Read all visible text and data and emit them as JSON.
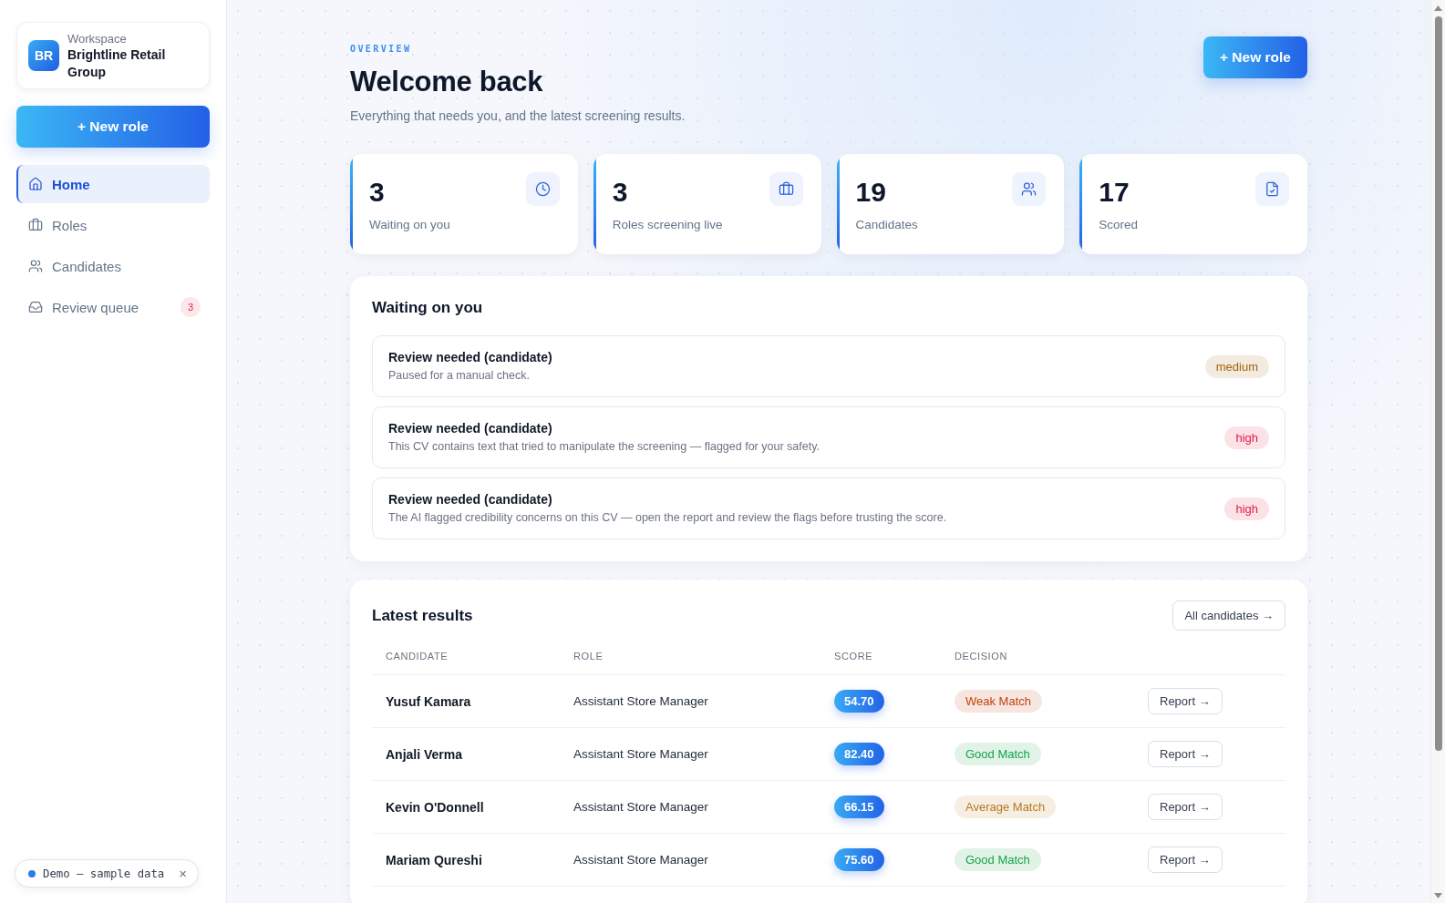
{
  "sidebar": {
    "workspace": {
      "logo": "BR",
      "label": "Workspace",
      "name": "Brightline Retail Group"
    },
    "new_role_button": "+ New role",
    "nav": [
      {
        "label": "Home",
        "selected": true
      },
      {
        "label": "Roles",
        "selected": false
      },
      {
        "label": "Candidates",
        "selected": false
      },
      {
        "label": "Review queue",
        "selected": false,
        "badge": "3"
      }
    ],
    "demo_banner": {
      "label": "Demo — sample data",
      "close": "×"
    }
  },
  "header": {
    "eyebrow": "OVERVIEW",
    "title": "Welcome back",
    "subtitle": "Everything that needs you, and the latest screening results.",
    "new_role_button": "+ New role"
  },
  "stats": [
    {
      "value": "3",
      "label": "Waiting on you"
    },
    {
      "value": "3",
      "label": "Roles screening live"
    },
    {
      "value": "19",
      "label": "Candidates"
    },
    {
      "value": "17",
      "label": "Scored"
    }
  ],
  "waiting": {
    "title": "Waiting on you",
    "items": [
      {
        "title": "Review needed (candidate)",
        "detail": "Paused for a manual check.",
        "priority": "medium",
        "color": "#a16207"
      },
      {
        "title": "Review needed (candidate)",
        "detail": "This CV contains text that tried to manipulate the screening — flagged for your safety.",
        "priority": "high",
        "color": "#e11d48"
      },
      {
        "title": "Review needed (candidate)",
        "detail": "The AI flagged credibility concerns on this CV — open the report and review the flags before trusting the score.",
        "priority": "high",
        "color": "#e11d48"
      }
    ]
  },
  "results": {
    "title": "Latest results",
    "all_button": "All candidates →",
    "columns": [
      "CANDIDATE",
      "ROLE",
      "SCORE",
      "DECISION"
    ],
    "rows": [
      {
        "candidate": "Yusuf Kamara",
        "role": "Assistant Store Manager",
        "score": "54.70",
        "decision": "Weak Match",
        "color": "#c2410c",
        "action": "Report →"
      },
      {
        "candidate": "Anjali Verma",
        "role": "Assistant Store Manager",
        "score": "82.40",
        "decision": "Good Match",
        "color": "#16a34a",
        "action": "Report →"
      },
      {
        "candidate": "Kevin O'Donnell",
        "role": "Assistant Store Manager",
        "score": "66.15",
        "decision": "Average Match",
        "color": "#b7791f",
        "action": "Report →"
      },
      {
        "candidate": "Mariam Qureshi",
        "role": "Assistant Store Manager",
        "score": "75.60",
        "decision": "Good Match",
        "color": "#16a34a",
        "action": "Report →"
      }
    ]
  }
}
